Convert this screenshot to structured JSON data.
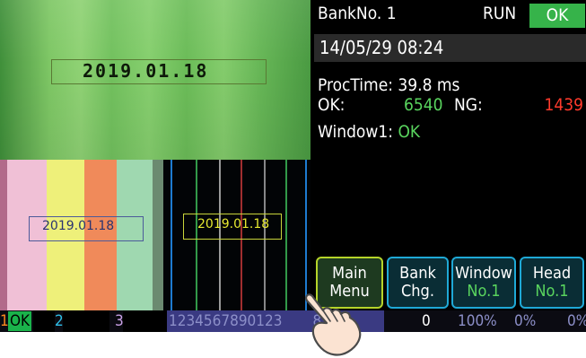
{
  "cameras": [
    {
      "ocr_text": "2019.01.18",
      "box_color": "#5a7a34"
    },
    {
      "ocr_text": "2019.01.18",
      "box_color": "#4c5a9a"
    },
    {
      "ocr_text": "2019.01.18",
      "box_color": "#c8d43a"
    }
  ],
  "info": {
    "bank_label": "BankNo. 1",
    "run_status": "RUN",
    "result": "OK",
    "datetime": "14/05/29 08:24",
    "proctime": "ProcTime:  39.8 ms",
    "ok_label": "OK:",
    "ok_count": "6540",
    "ng_label": "NG:",
    "ng_count": "1439",
    "window1_label": "Window1: ",
    "window1_value": "OK"
  },
  "buttons": {
    "main": {
      "line1": "Main",
      "line2": "Menu"
    },
    "bank": {
      "line1": "Bank",
      "line2": "Chg."
    },
    "window": {
      "line1": "Window",
      "line2": "No.1"
    },
    "head": {
      "line1": "Head",
      "line2": "No.1"
    }
  },
  "statusbar": {
    "cam1_num": "1",
    "cam1_result": "OK",
    "cam2_num": "2",
    "cam3_num": "3",
    "digits": "1234567890123",
    "digits_tail": "890",
    "count": "0",
    "pct1": "100%",
    "pct2": "0%",
    "pct3": "0%"
  },
  "colors": {
    "ok_green": "#36b34a",
    "ng_red": "#ff3a2c",
    "button_border": "#1fa9d6",
    "selected_button_border": "#b5d42a"
  },
  "icons": {
    "touch": "pointing-hand-icon"
  }
}
